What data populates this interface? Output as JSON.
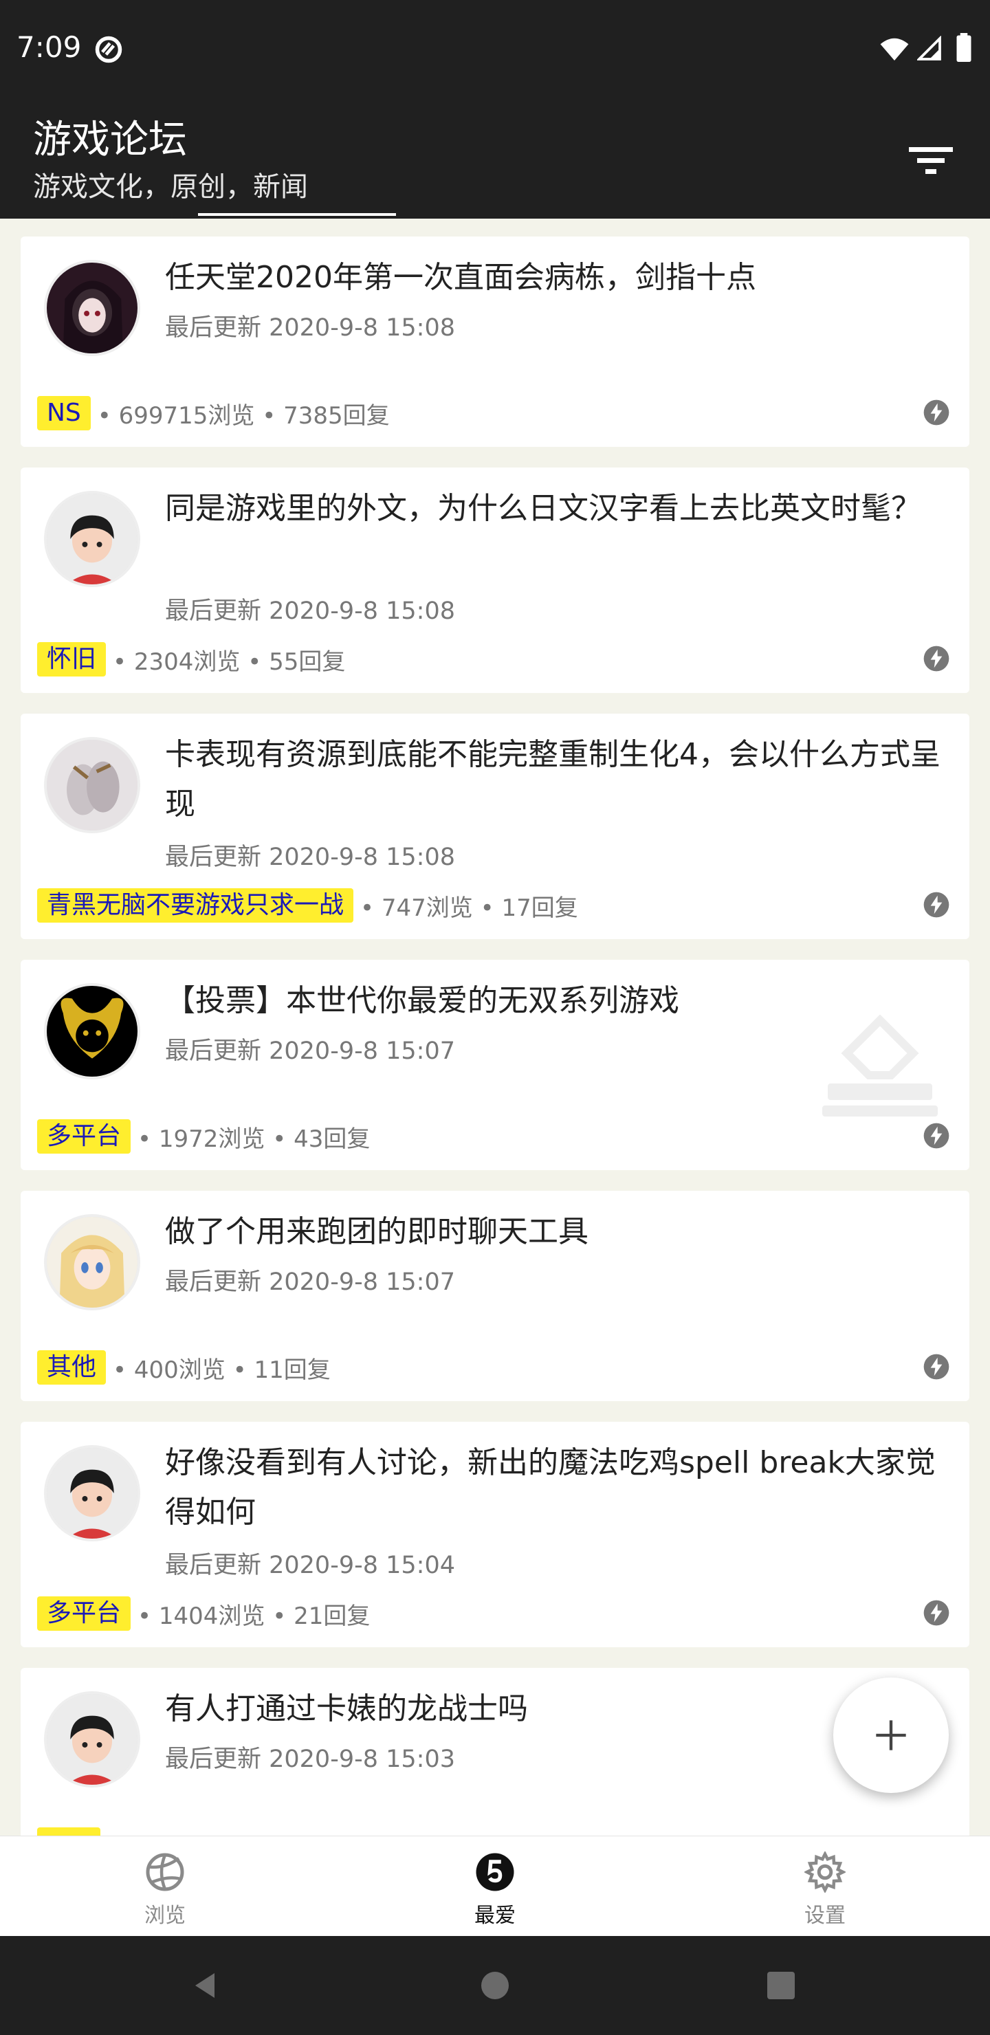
{
  "status_bar": {
    "time": "7:09"
  },
  "app_bar": {
    "title": "游戏论坛",
    "subtitle": "游戏文化，原创，新闻"
  },
  "posts": [
    {
      "title": "任天堂2020年第一次直面会病栋，剑指十点",
      "updated": "最后更新 2020-9-8 15:08",
      "tag": "NS",
      "stats": "• 699715浏览 • 7385回复"
    },
    {
      "title": "同是游戏里的外文，为什么日文汉字看上去比英文时髦？",
      "updated": "最后更新 2020-9-8 15:08",
      "tag": "怀旧",
      "stats": "• 2304浏览 • 55回复"
    },
    {
      "title": "卡表现有资源到底能不能完整重制生化4，会以什么方式呈现",
      "updated": "最后更新 2020-9-8 15:08",
      "tag": "青黑无脑不要游戏只求一战",
      "stats": "• 747浏览 • 17回复"
    },
    {
      "title": "【投票】本世代你最爱的无双系列游戏",
      "updated": "最后更新 2020-9-8 15:07",
      "tag": "多平台",
      "stats": "• 1972浏览 • 43回复"
    },
    {
      "title": "做了个用来跑团的即时聊天工具",
      "updated": "最后更新 2020-9-8 15:07",
      "tag": "其他",
      "stats": "• 400浏览 • 11回复"
    },
    {
      "title": "好像没看到有人讨论，新出的魔法吃鸡spell break大家觉得如何",
      "updated": "最后更新 2020-9-8 15:04",
      "tag": "多平台",
      "stats": "• 1404浏览 • 21回复"
    },
    {
      "title": "有人打通过卡婊的龙战士吗",
      "updated": "最后更新 2020-9-8 15:03"
    }
  ],
  "bottom_nav": {
    "browse": "浏览",
    "favorites": "最爱",
    "settings": "设置"
  },
  "colors": {
    "bar": "#202020",
    "tag_bg": "#ffee2e",
    "tag_text": "#1a1ab8"
  },
  "icons": [
    "sync-icon",
    "wifi-icon",
    "signal-icon",
    "battery-icon",
    "filter-icon",
    "bolt-icon",
    "add-icon",
    "volleyball-icon",
    "favorite-badge-icon",
    "gear-icon",
    "back-icon",
    "home-icon",
    "recents-icon"
  ]
}
